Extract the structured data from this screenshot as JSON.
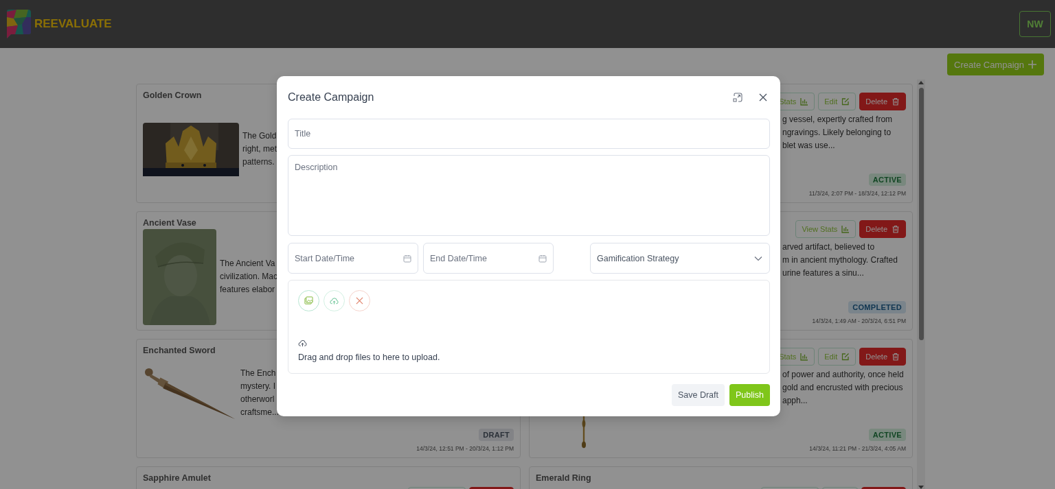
{
  "header": {
    "logo_text": "REEVALUATE",
    "avatar": "NW"
  },
  "create_button": "Create Campaign",
  "cards": [
    {
      "title": "Golden Crown",
      "picture": true,
      "lines": [
        "The Gold",
        "right, met",
        "patterns."
      ]
    },
    {
      "buttons": [
        {
          "kind": "stats",
          "label": "Stats"
        },
        {
          "kind": "edit",
          "label": "Edit"
        },
        {
          "kind": "delete",
          "label": "Delete"
        }
      ],
      "lines": [
        "g vessel, expertly crafted from",
        "ngravings. Likely belonging to",
        "blet was use..."
      ],
      "badge": {
        "label": "ACTIVE",
        "kind": "active"
      },
      "date": "11/3/24, 2:07 PM - 18/3/24, 12:12 PM"
    },
    {
      "title": "Ancient Vase",
      "picture": true,
      "lines": [
        "The Ancient Va",
        "civilization. Mac",
        "features elabor"
      ]
    },
    {
      "buttons": [
        {
          "kind": "stats",
          "label": "View Stats"
        },
        {
          "kind": "delete",
          "label": "Delete"
        }
      ],
      "lines": [
        "arved artifact, believed to",
        "m in ancient mythology. Crafted",
        "urine features a sinu..."
      ],
      "badge": {
        "label": "COMPLETED",
        "kind": "completed"
      },
      "date": "14/3/24, 1:49 AM - 20/3/24, 6:51 PM"
    },
    {
      "title": "Enchanted Sword",
      "picture": true,
      "lines": [
        "The Ench",
        "mystery. I",
        "otherworl",
        "craftsme..."
      ],
      "badge": {
        "label": "DRAFT",
        "kind": "draft"
      },
      "date": "14/3/24, 12:51 PM - 20/3/24, 1:12 PM"
    },
    {
      "picture": true,
      "buttons": [
        {
          "kind": "stats",
          "label": "Stats"
        },
        {
          "kind": "edit",
          "label": "Edit"
        },
        {
          "kind": "delete",
          "label": "Delete"
        }
      ],
      "lines": [
        "of power and authority, once held",
        "gold and encrusted with precious",
        "apph..."
      ],
      "badge": {
        "label": "ACTIVE",
        "kind": "active"
      },
      "date": "14/3/24, 11:21 PM - 21/3/24, 4:05 AM"
    },
    {
      "title": "Sapphire Amulet",
      "buttons": [
        {
          "kind": "stats"
        },
        {
          "kind": "delete"
        }
      ]
    },
    {
      "title": "Emerald Ring",
      "buttons": [
        {
          "kind": "stats"
        },
        {
          "kind": "edit"
        },
        {
          "kind": "delete"
        }
      ]
    }
  ],
  "modal": {
    "title": "Create Campaign",
    "title_field": {
      "placeholder": "Title"
    },
    "description_field": {
      "placeholder": "Description"
    },
    "start_field": {
      "placeholder": "Start Date/Time"
    },
    "end_field": {
      "placeholder": "End Date/Time"
    },
    "strategy_select": {
      "placeholder": "Gamification Strategy"
    },
    "upload_text": "Drag and drop files to here to upload.",
    "save_button": "Save Draft",
    "publish_button": "Publish"
  }
}
